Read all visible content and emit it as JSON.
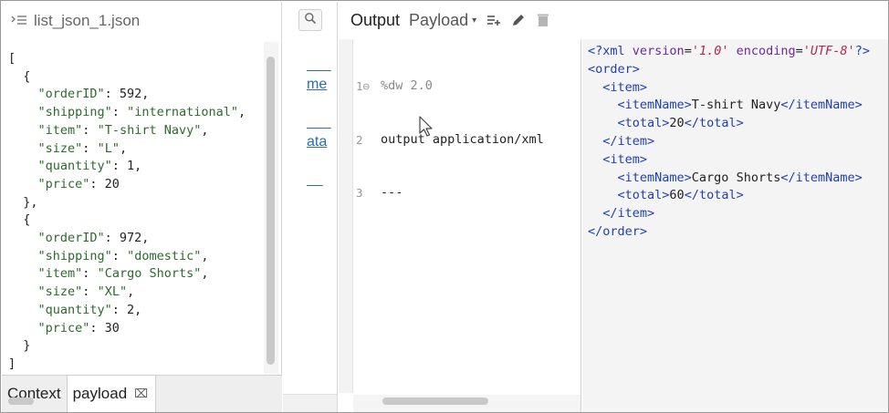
{
  "left_panel": {
    "file_name": "list_json_1.json",
    "file_icon": "json-file-icon",
    "code_lines": [
      "[",
      "  {",
      "    \"orderID\": 592,",
      "    \"shipping\": \"international\",",
      "    \"item\": \"T-shirt Navy\",",
      "    \"size\": \"L\",",
      "    \"quantity\": 1,",
      "    \"price\": 20",
      "  },",
      "  {",
      "    \"orderID\": 972,",
      "    \"shipping\": \"domestic\",",
      "    \"item\": \"Cargo Shorts\",",
      "    \"size\": \"XL\",",
      "    \"quantity\": 2,",
      "    \"price\": 30",
      "  }",
      "]"
    ],
    "tabs": [
      {
        "label": "Context"
      },
      {
        "label": "payload",
        "close_glyph": "⌧"
      }
    ]
  },
  "middle": {
    "search_icon": "search-icon",
    "links": [
      "me",
      "ata"
    ]
  },
  "transform_header": {
    "output_label": "Output",
    "payload_label": "Payload",
    "caret": "▾",
    "icons": [
      "add-target-icon",
      "edit-pencil-icon",
      "delete-trash-icon"
    ]
  },
  "script": {
    "line_numbers": [
      "1⊖",
      "2",
      "3"
    ],
    "lines": [
      "%dw 2.0",
      "output application/xml",
      "---"
    ]
  },
  "output": {
    "xml_lines": [
      "<?xml version='1.0' encoding='UTF-8'?>",
      "<order>",
      "  <item>",
      "    <itemName>T-shirt Navy</itemName>",
      "    <total>20</total>",
      "  </item>",
      "  <item>",
      "    <itemName>Cargo Shorts</itemName>",
      "    <total>60</total>",
      "  </item>",
      "</order>"
    ]
  },
  "colors": {
    "json_string": "#2b6b2b",
    "xml_tag": "#1f3fb3",
    "xml_attr": "#6a2aa0",
    "xml_value": "#b0285a",
    "link": "#2a6db0"
  }
}
